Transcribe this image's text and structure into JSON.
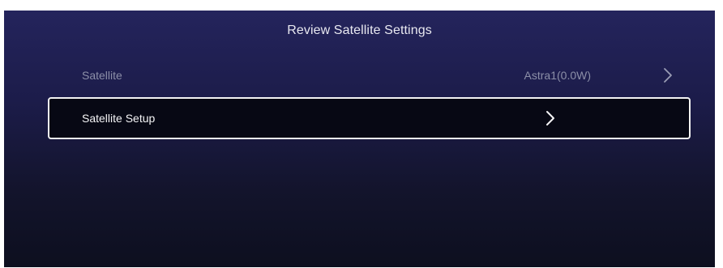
{
  "header": {
    "title": "Review Satellite Settings"
  },
  "rows": [
    {
      "label": "Satellite",
      "value": "Astra1(0.0W)",
      "icon": "chevron-right-icon"
    },
    {
      "label": "Satellite Setup",
      "icon": "chevron-right-icon",
      "selected": true
    }
  ],
  "colors": {
    "background_top": "#24245c",
    "background_bottom": "#0d0f1f",
    "focus_border": "#f2f2f2",
    "dim_text": "#8c8fa8",
    "bright_text": "#f4f4f6"
  }
}
